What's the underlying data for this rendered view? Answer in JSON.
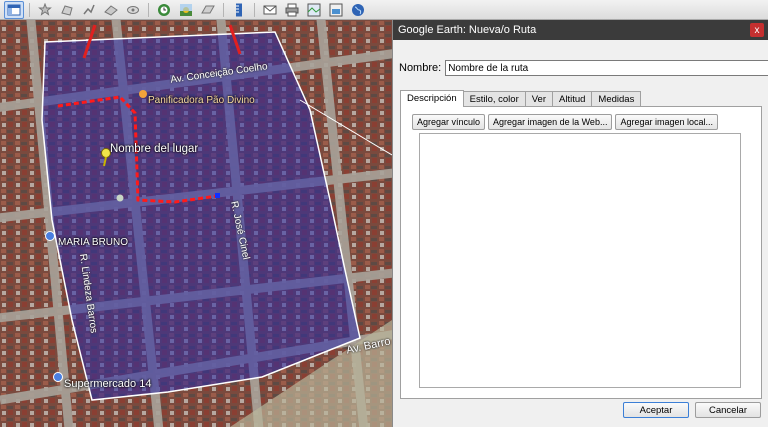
{
  "toolbar": {
    "icons": [
      "sidebar-toggle-icon",
      "add-placemark-icon",
      "add-polygon-icon",
      "add-path-icon",
      "add-image-overlay-icon",
      "record-tour-icon",
      "historical-imagery-icon",
      "sunlight-icon",
      "planets-icon",
      "ruler-icon",
      "email-icon",
      "print-icon",
      "view-in-maps-icon",
      "save-image-icon",
      "earth-icon"
    ]
  },
  "map": {
    "placemark_label": "Nombre del lugar",
    "poi_bakery": "Panificadora Pão Divino",
    "poi_maria": "MARIA BRUNO",
    "poi_market": "Supermercado 14",
    "road_1": "Av. Conceição Coelho",
    "road_2": "R. José Cinel",
    "road_3": "R. Lindeza Barros",
    "road_4": "Av. Barro"
  },
  "dialog": {
    "title": "Google Earth: Nueva/o Ruta",
    "close_label": "x",
    "name_label": "Nombre:",
    "name_value": "Nombre de la ruta",
    "tabs": [
      "Descripción",
      "Estilo, color",
      "Ver",
      "Altitud",
      "Medidas"
    ],
    "buttons": {
      "add_link": "Agregar vínculo",
      "add_web_image": "Agregar imagen de la Web...",
      "add_local_image": "Agregar imagen local..."
    },
    "ok": "Aceptar",
    "cancel": "Cancelar"
  }
}
